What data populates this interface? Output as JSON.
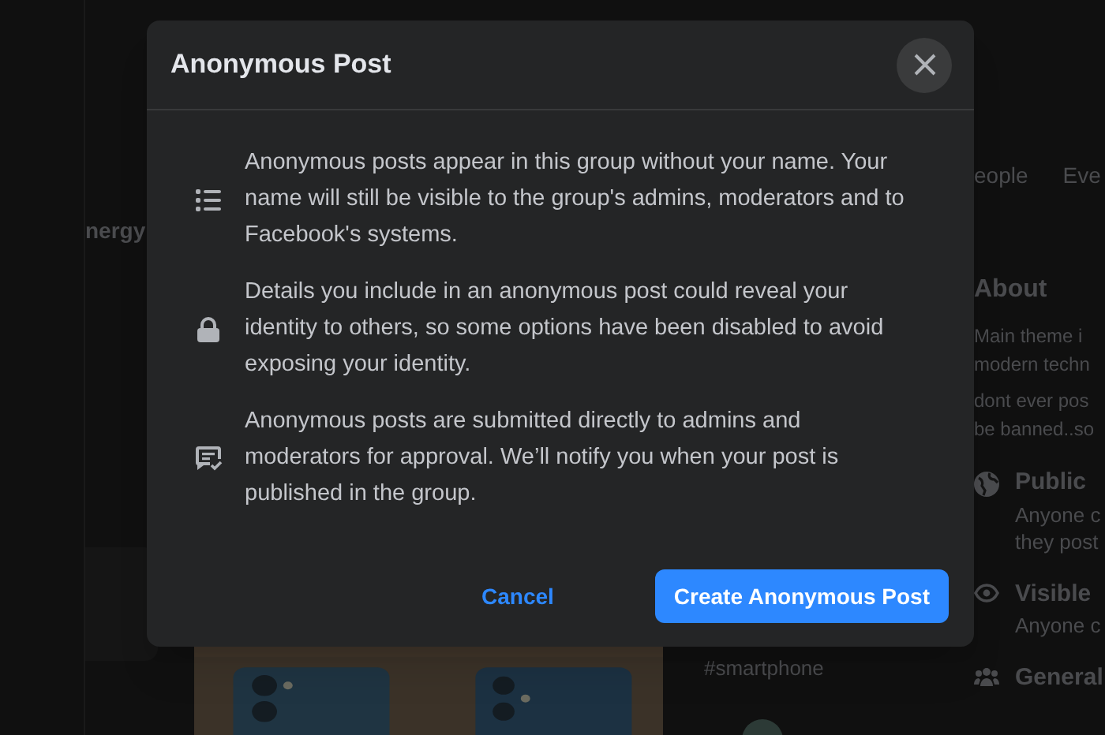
{
  "background": {
    "sidebar_item": "nergy",
    "tabs": [
      "eople",
      "Eve"
    ],
    "about": {
      "heading": "About",
      "description": [
        "Main theme i",
        "modern techn"
      ],
      "rule": [
        "dont ever pos",
        "be banned..so"
      ],
      "details": [
        {
          "kind": "public",
          "title": "Public",
          "lines": [
            "Anyone c",
            "they post"
          ]
        },
        {
          "kind": "visible",
          "title": "Visible",
          "lines": [
            "Anyone c"
          ]
        },
        {
          "kind": "general",
          "title": "General"
        }
      ]
    },
    "post": {
      "kind": "picture"
    },
    "hashtag": "#smartphone"
  },
  "dialog": {
    "title": "Anonymous Post",
    "items": [
      {
        "kind": "list",
        "text": "Anonymous posts appear in this group without your name. Your name will still be visible to the group's admins, moderators and to Facebook's systems."
      },
      {
        "kind": "lock",
        "text": "Details you include in an anonymous post could reveal your identity to others, so some options have been disabled to avoid exposing your identity."
      },
      {
        "kind": "approval",
        "text": "Anonymous posts are submitted directly to admins and moderators for approval. We’ll notify you when your post is published in the group."
      }
    ],
    "buttons": [
      {
        "kind": "secondary",
        "label": "Cancel"
      },
      {
        "kind": "primary",
        "label": "Create Anonymous Post"
      }
    ]
  }
}
